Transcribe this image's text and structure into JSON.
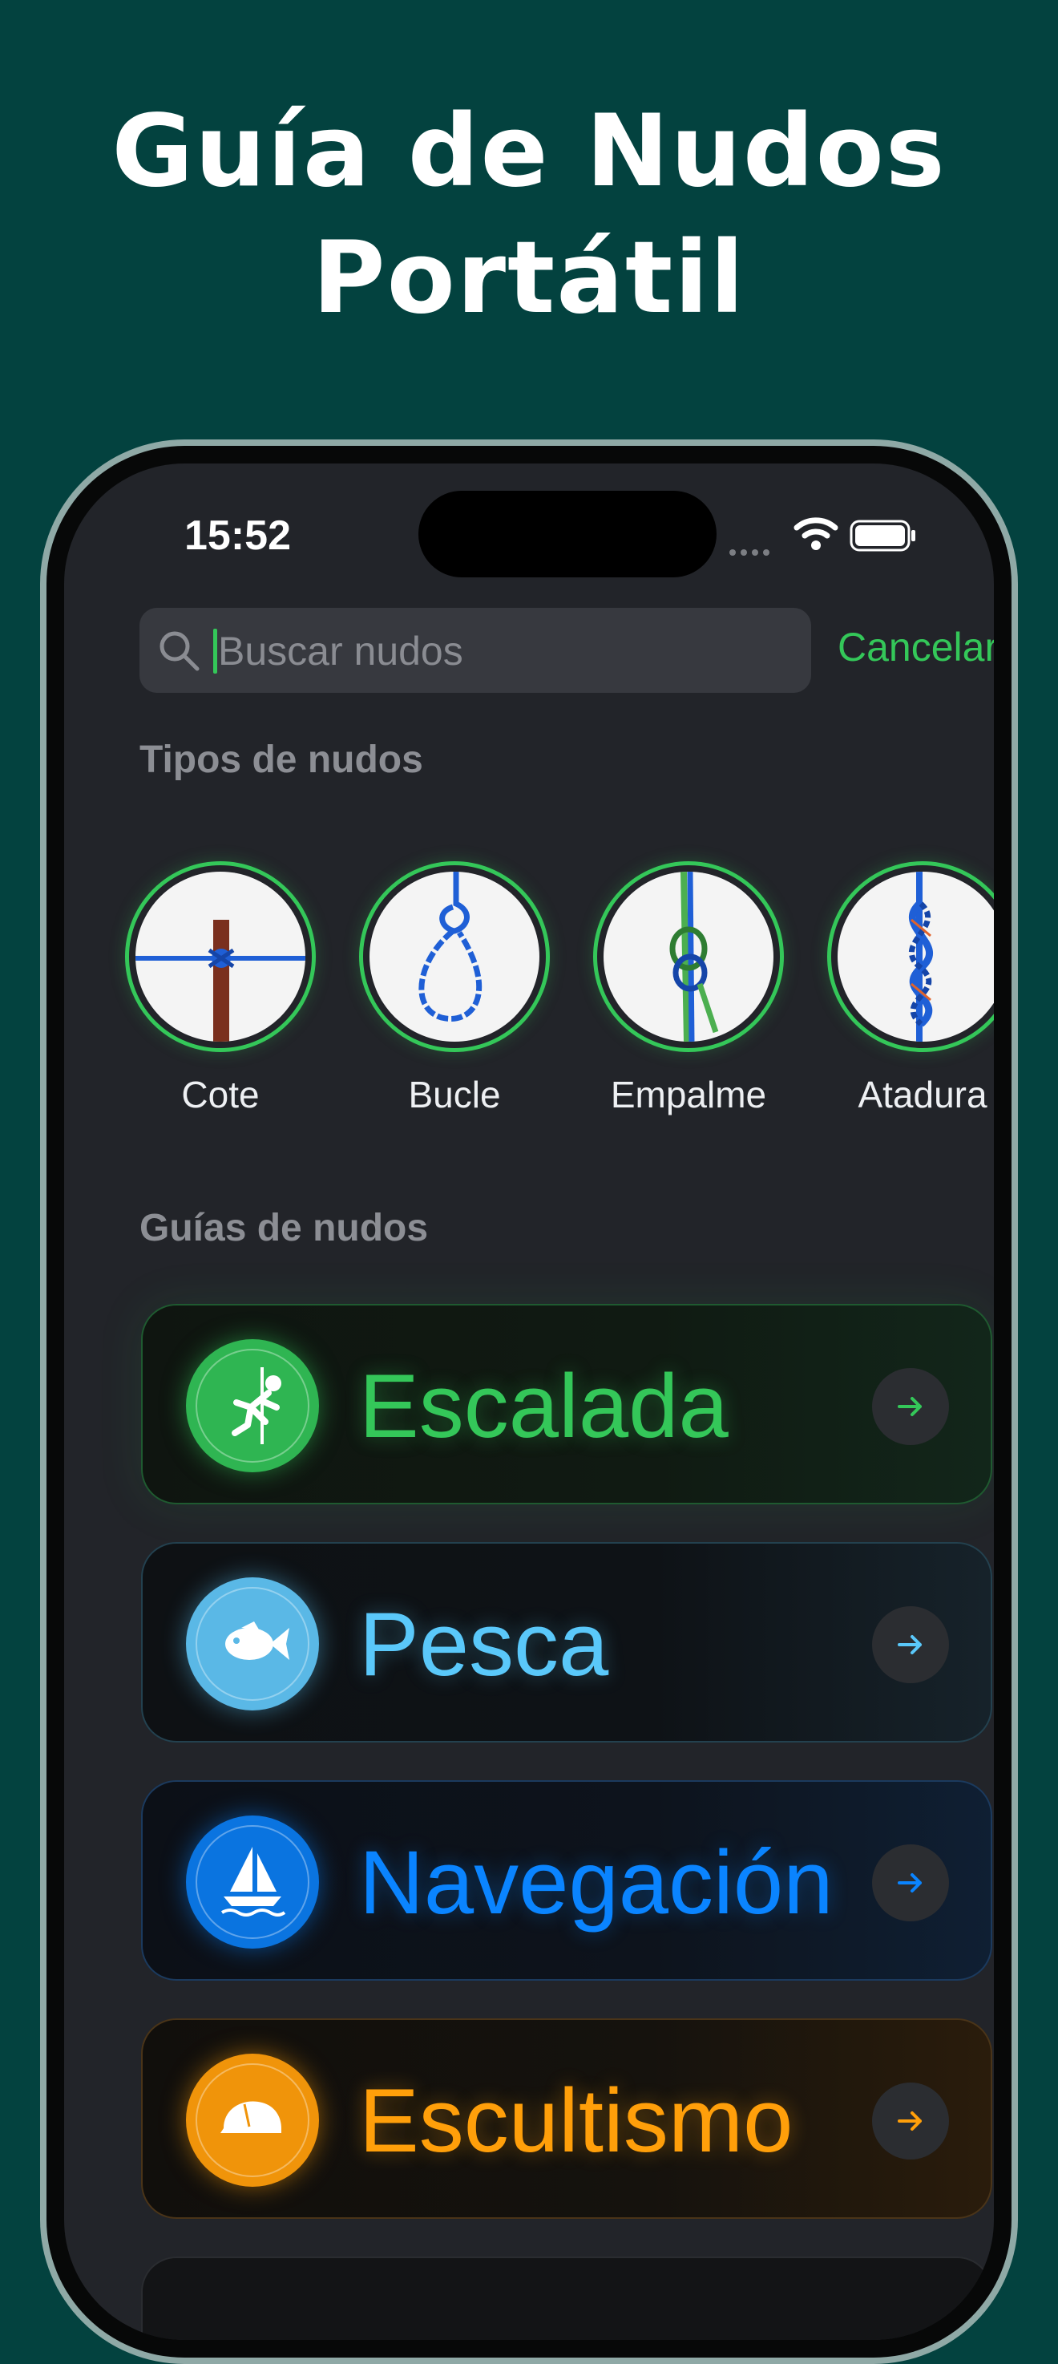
{
  "headline": {
    "line1": "Guía de Nudos",
    "line2": "Portátil"
  },
  "status_bar": {
    "time": "15:52"
  },
  "search": {
    "placeholder": "Buscar nudos",
    "value": "",
    "cancel_label": "Cancelar"
  },
  "knot_types": {
    "title": "Tipos de nudos",
    "items": [
      {
        "label": "Cote",
        "icon": "hitch-knot-image"
      },
      {
        "label": "Bucle",
        "icon": "loop-knot-image"
      },
      {
        "label": "Empalme",
        "icon": "bend-knot-image"
      },
      {
        "label": "Atadura",
        "icon": "binding-knot-image"
      }
    ]
  },
  "guides": {
    "title": "Guías de nudos",
    "items": [
      {
        "label": "Escalada",
        "icon": "climber-icon",
        "color": "#34c759"
      },
      {
        "label": "Pesca",
        "icon": "fish-icon",
        "color": "#5ac8fa"
      },
      {
        "label": "Navegación",
        "icon": "sailboat-icon",
        "color": "#0a84ff"
      },
      {
        "label": "Escultismo",
        "icon": "cap-icon",
        "color": "#ff9f0a"
      }
    ]
  },
  "colors": {
    "background": "#03423f",
    "screen": "#222429",
    "accent": "#34c759"
  }
}
